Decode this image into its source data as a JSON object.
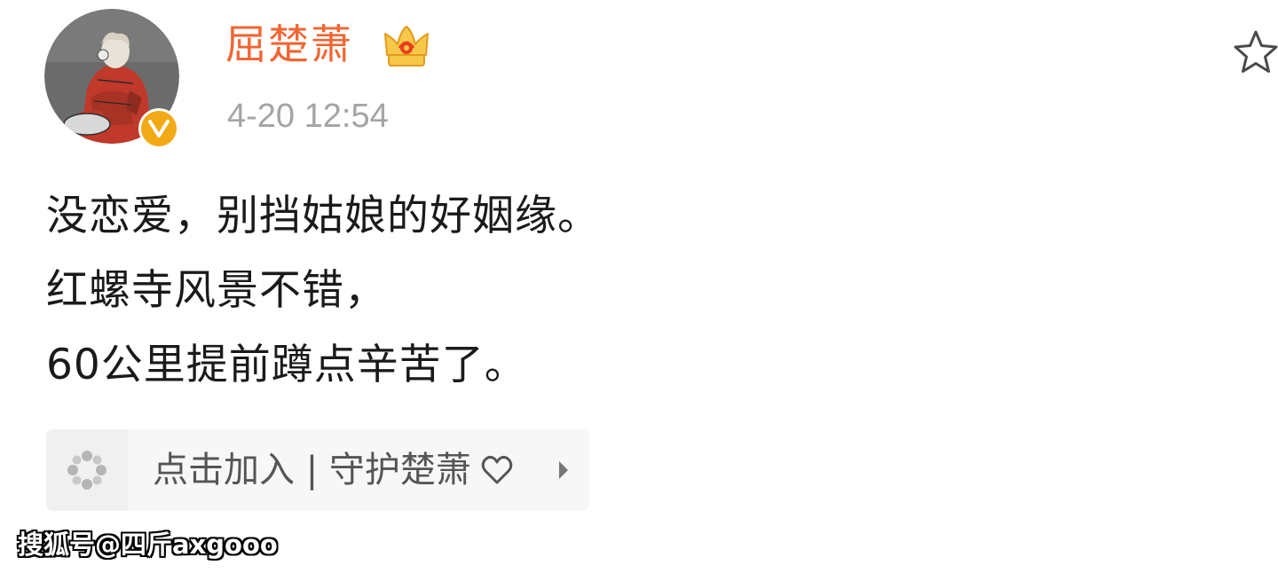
{
  "post": {
    "username": "屈楚萧",
    "timestamp": "4-20 12:54",
    "body_lines": [
      "没恋爱，别挡姑娘的好姻缘。",
      "红螺寺风景不错，",
      "60公里提前蹲点辛苦了。"
    ]
  },
  "fan_card": {
    "label": "点击加入 | 守护楚萧"
  },
  "watermark": {
    "text": "搜狐号@四斤axgooo"
  },
  "icons": {
    "avatar": "avatar-illustration",
    "verified": "verified-v-icon",
    "crown": "crown-icon",
    "star": "star-outline-icon",
    "fan_group": "flower-dots-icon",
    "heart": "heart-outline-icon",
    "arrow": "chevron-right-icon"
  },
  "colors": {
    "username": "#f06633",
    "timestamp": "#a4a4a4",
    "verified": "#f1a916",
    "body_text": "#1a1a1a",
    "card_bg": "#f7f7f7"
  }
}
